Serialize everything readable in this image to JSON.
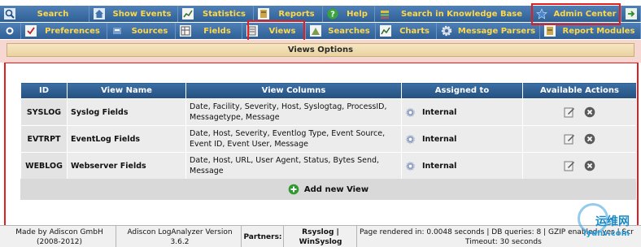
{
  "nav": {
    "row1": [
      {
        "label": "Search",
        "icon": "search-icon"
      },
      {
        "label": "Show Events",
        "icon": "home-icon"
      },
      {
        "label": "Statistics",
        "icon": "chart-icon"
      },
      {
        "label": "Reports",
        "icon": "report-icon"
      },
      {
        "label": "Help",
        "icon": "help-icon"
      },
      {
        "label": "Search in Knowledge Base",
        "icon": "knowledge-base-icon"
      },
      {
        "label": "Admin Center",
        "icon": "star-icon"
      },
      {
        "label": "",
        "icon": "logout-icon"
      }
    ],
    "row2": [
      {
        "label": "",
        "icon": "dot-icon"
      },
      {
        "label": "Preferences",
        "icon": "preferences-icon"
      },
      {
        "label": "Sources",
        "icon": "sources-icon"
      },
      {
        "label": "Fields",
        "icon": "fields-icon"
      },
      {
        "label": "Views",
        "icon": "views-icon"
      },
      {
        "label": "Searches",
        "icon": "searches-icon"
      },
      {
        "label": "Charts",
        "icon": "charts-icon"
      },
      {
        "label": "Message Parsers",
        "icon": "gear-icon"
      },
      {
        "label": "Report Modules",
        "icon": "report-modules-icon"
      }
    ]
  },
  "section_title": "Views Options",
  "table": {
    "headers": [
      "ID",
      "View Name",
      "View Columns",
      "Assigned to",
      "Available Actions"
    ],
    "rows": [
      {
        "id": "SYSLOG",
        "name": "Syslog Fields",
        "columns": "Date, Facility, Severity, Host, Syslogtag, ProcessID, Messagetype, Message",
        "assigned": "Internal"
      },
      {
        "id": "EVTRPT",
        "name": "EventLog Fields",
        "columns": "Date, Host, Severity, Eventlog Type, Event Source, Event ID, Event User, Message",
        "assigned": "Internal"
      },
      {
        "id": "WEBLOG",
        "name": "Webserver Fields",
        "columns": "Date, Host, URL, User Agent, Status, Bytes Send, Message",
        "assigned": "Internal"
      }
    ]
  },
  "add_label": "Add new View",
  "footer": {
    "made_by": "Made by Adiscon GmbH",
    "years": "(2008-2012)",
    "product": "Adiscon LogAnalyzer Version",
    "version": "3.6.2",
    "partners": "Partners:",
    "partner1": "Rsyslog |",
    "partner2": "WinSyslog",
    "rendered": "Page rendered in: 0.0048 seconds",
    "db_queries": "| DB queries: 8 | GZIP enabled: yes | Scr",
    "timeout": "Timeout: 30 seconds"
  },
  "watermark": {
    "cn": "运维网",
    "url": "iyunv.com"
  },
  "colors": {
    "nav_bg": "#3d6a9e",
    "nav_text": "#ffd84a",
    "highlight": "#e41e1e",
    "header_bg": "#2e5f95"
  }
}
